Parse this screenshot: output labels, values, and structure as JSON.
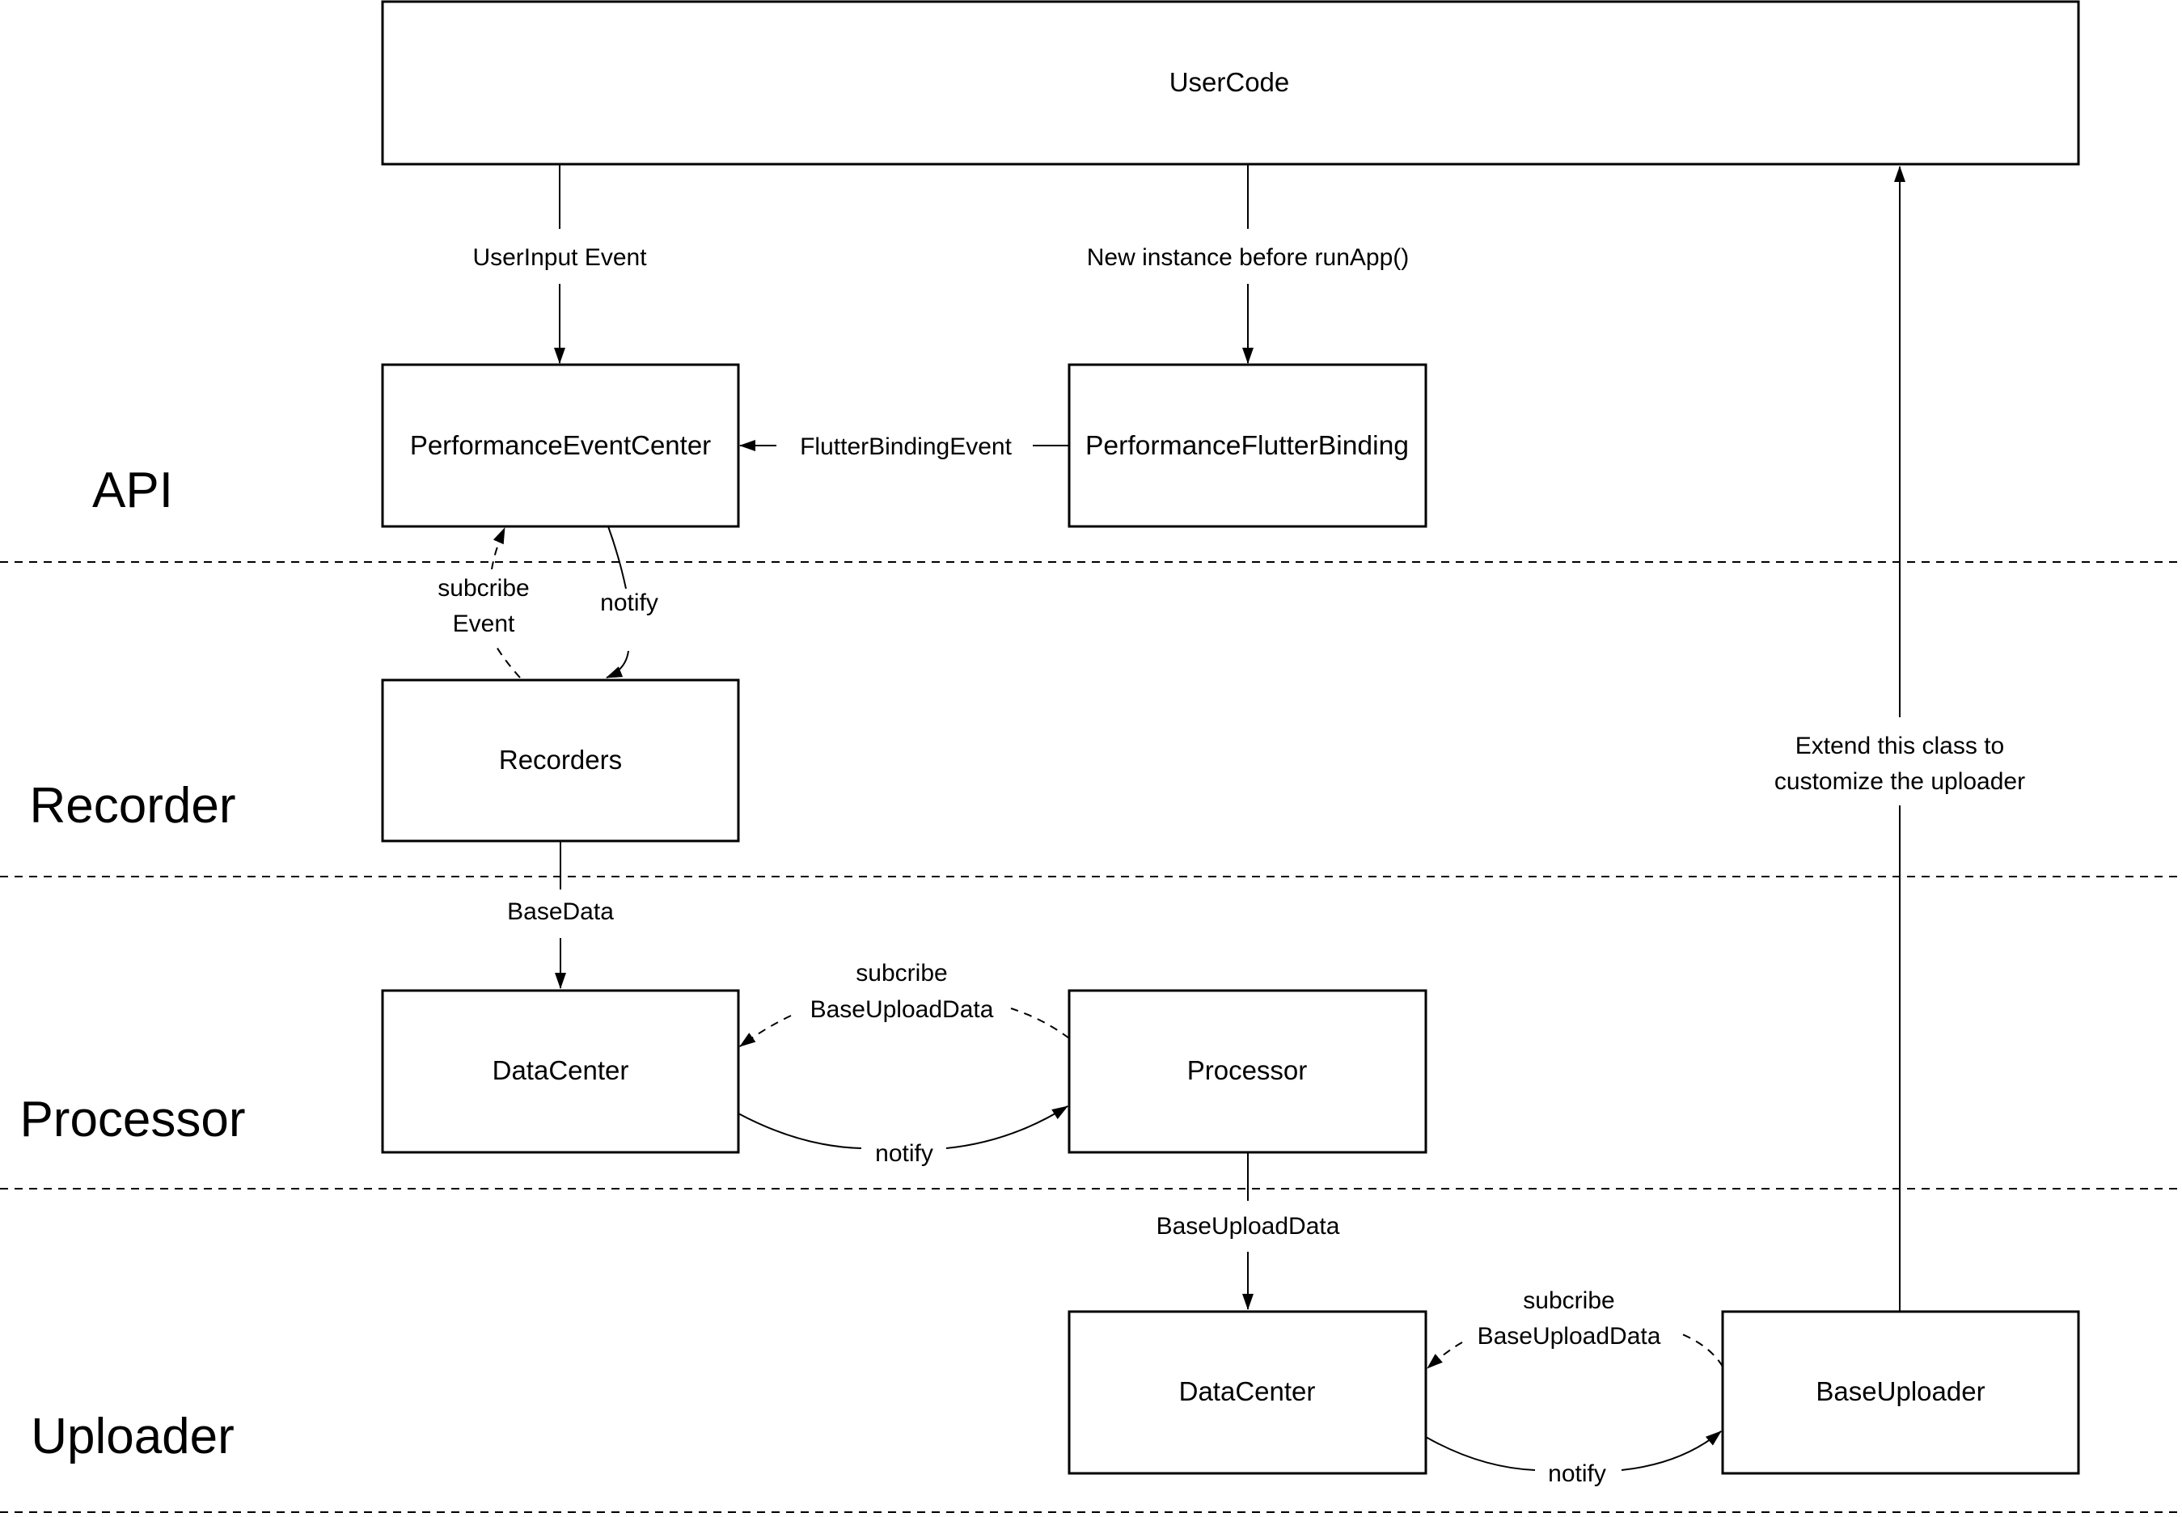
{
  "diagram": {
    "layers": [
      {
        "id": "api",
        "label": "API"
      },
      {
        "id": "recorder",
        "label": "Recorder"
      },
      {
        "id": "processor",
        "label": "Processor"
      },
      {
        "id": "uploader",
        "label": "Uploader"
      }
    ],
    "nodes": {
      "usercode": {
        "label": "UserCode"
      },
      "event_center": {
        "label": "PerformanceEventCenter"
      },
      "flutter_binding": {
        "label": "PerformanceFlutterBinding"
      },
      "recorders": {
        "label": "Recorders"
      },
      "proc_datacenter": {
        "label": "DataCenter"
      },
      "processor": {
        "label": "Processor"
      },
      "upl_datacenter": {
        "label": "DataCenter"
      },
      "base_uploader": {
        "label": "BaseUploader"
      }
    },
    "edges": {
      "userinput": {
        "label": "UserInput Event"
      },
      "new_instance": {
        "label": "New instance before runApp()"
      },
      "flutter_binding_event": {
        "label": "FlutterBindingEvent"
      },
      "subscribe_event": {
        "line1": "subcribe",
        "line2": "Event"
      },
      "notify_recorders": {
        "label": "notify"
      },
      "basedata": {
        "label": "BaseData"
      },
      "subscribe_proc": {
        "line1": "subcribe",
        "line2": "BaseUploadData"
      },
      "notify_processor": {
        "label": "notify"
      },
      "baseuploaddata": {
        "label": "BaseUploadData"
      },
      "subscribe_upl": {
        "line1": "subcribe",
        "line2": "BaseUploadData"
      },
      "notify_uploader": {
        "label": "notify"
      },
      "extend": {
        "line1": "Extend this class to",
        "line2": "customize the uploader"
      }
    }
  }
}
